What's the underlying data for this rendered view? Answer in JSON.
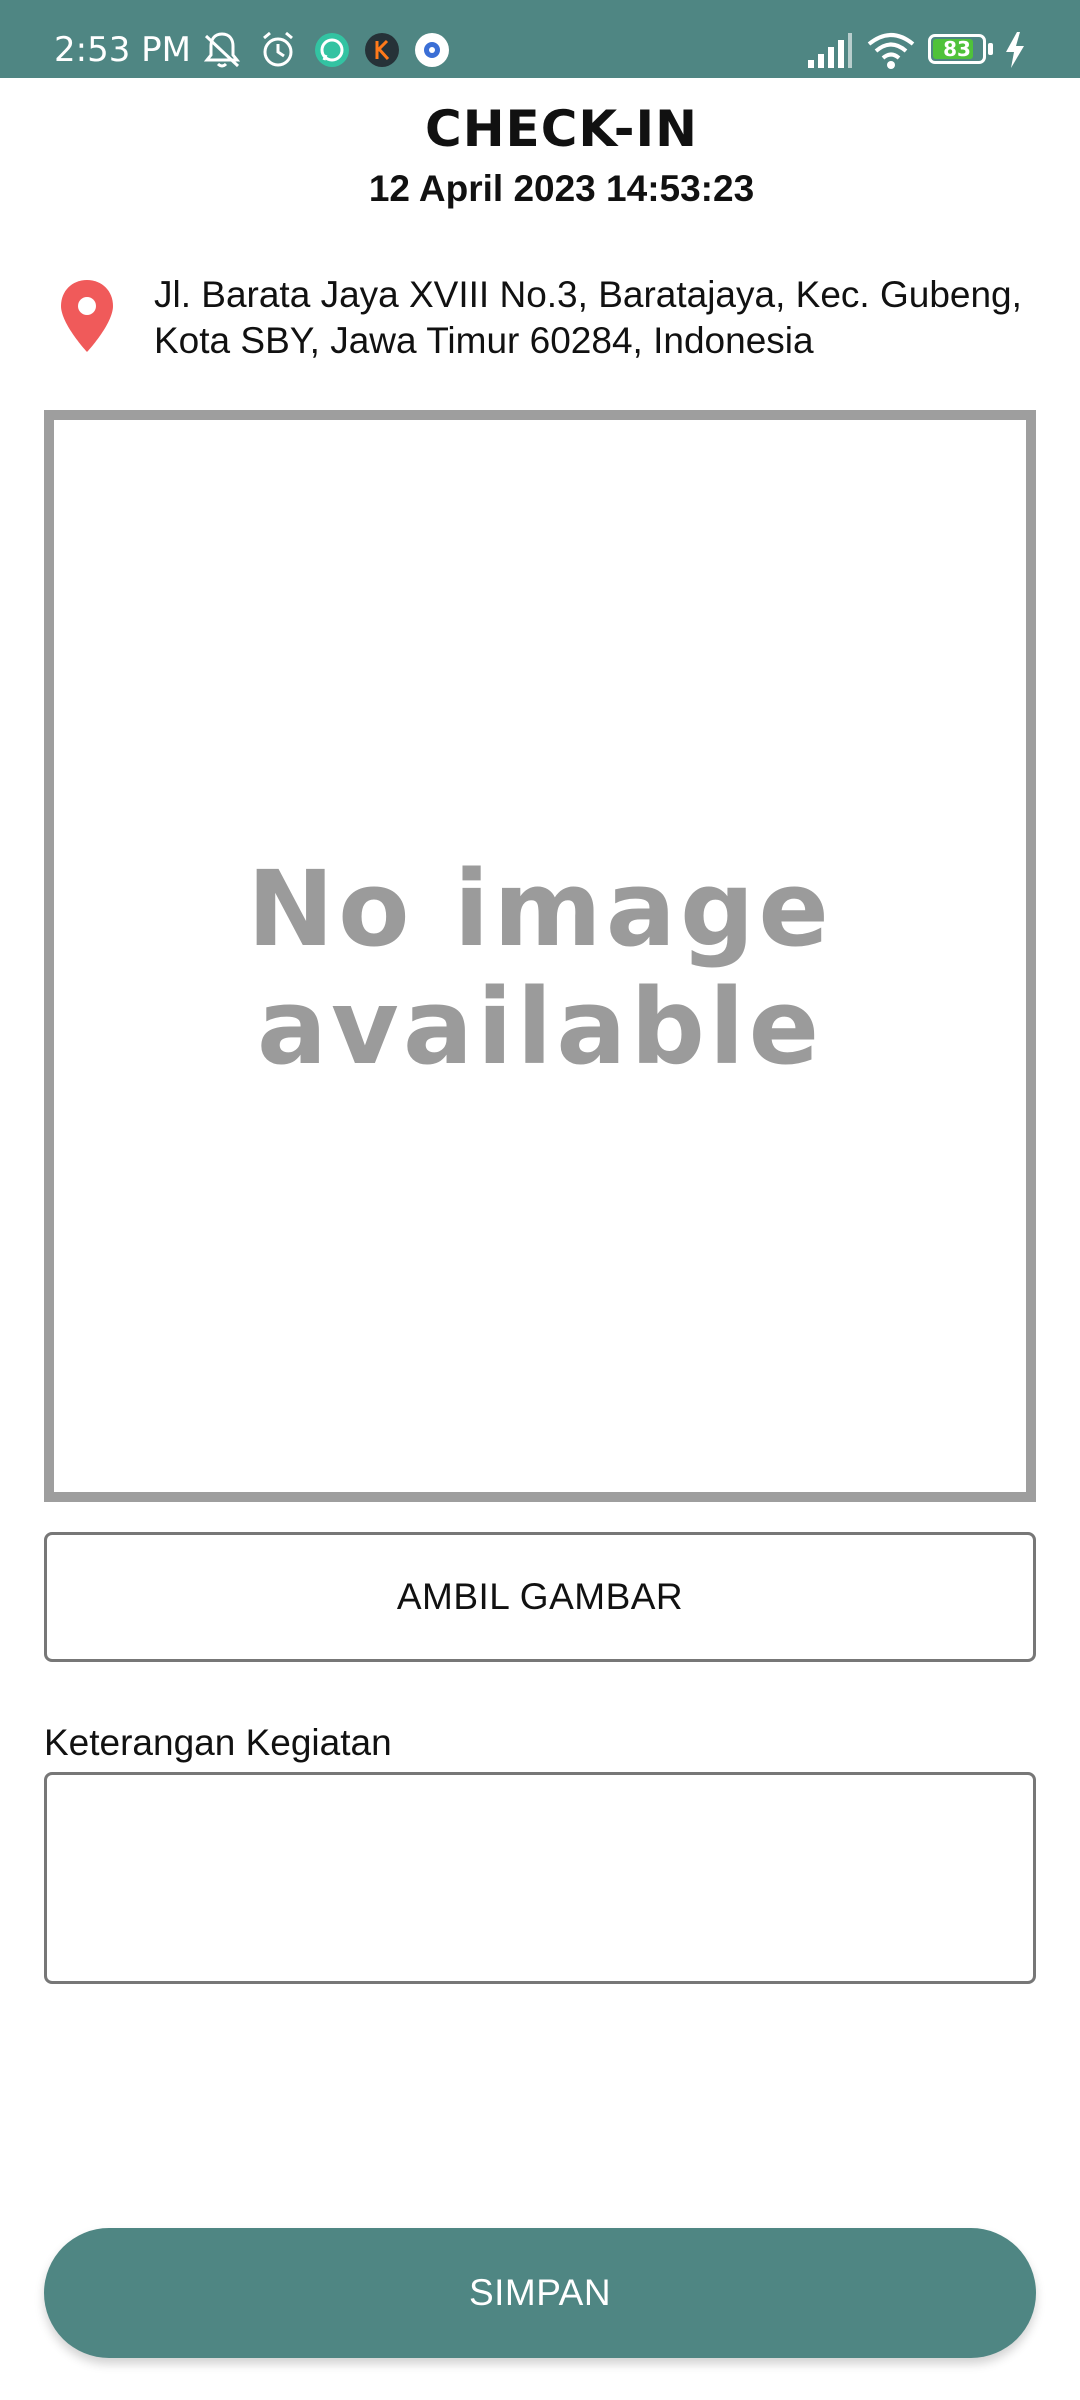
{
  "status_bar": {
    "time": "2:53 PM",
    "battery": "83",
    "background": "#4f8683",
    "icons": [
      "muted-bell-icon",
      "alarm-icon",
      "whatsapp-icon",
      "kik-icon",
      "settings-icon",
      "signal-icon",
      "wifi-icon",
      "battery-icon",
      "charging-icon"
    ]
  },
  "header": {
    "title": "CHECK-IN",
    "datetime": "12 April 2023 14:53:23"
  },
  "location": {
    "icon": "location-pin-icon",
    "pin_color": "#f05a5a",
    "address": "Jl. Barata Jaya XVIII No.3, Baratajaya, Kec. Gubeng, Kota SBY, Jawa Timur 60284, Indonesia"
  },
  "photo": {
    "placeholder_line1": "No image",
    "placeholder_line2": "available"
  },
  "actions": {
    "take_picture_label": "AMBIL GAMBAR",
    "save_label": "SIMPAN",
    "accent": "#4f8683"
  },
  "form": {
    "activity_label": "Keterangan Kegiatan",
    "activity_value": ""
  }
}
